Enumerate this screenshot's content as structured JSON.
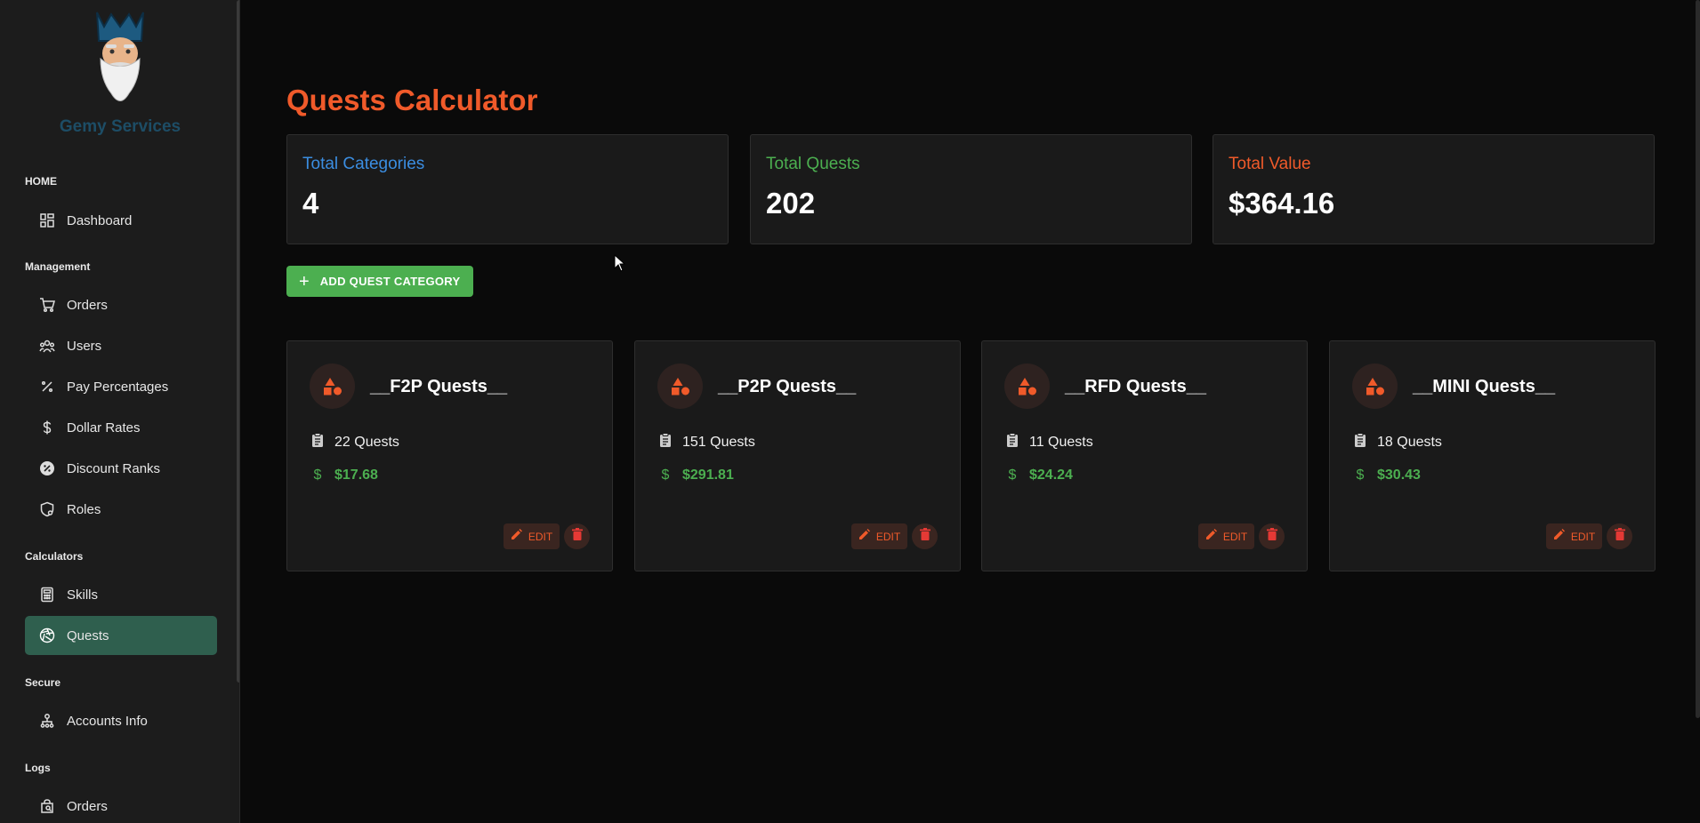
{
  "colors": {
    "accent": "#f05a2a",
    "green": "#4caf50",
    "blue": "#3b8de0",
    "activeNav": "#2f5f4e"
  },
  "sidebar": {
    "brand": "Gemy Services",
    "sections": {
      "home": "HOME",
      "management": "Management",
      "calculators": "Calculators",
      "secure": "Secure",
      "logs": "Logs"
    },
    "items": [
      {
        "label": "Dashboard",
        "icon": "dashboard-icon"
      },
      {
        "label": "Orders",
        "icon": "cart-icon"
      },
      {
        "label": "Users",
        "icon": "users-icon"
      },
      {
        "label": "Pay Percentages",
        "icon": "percent-icon"
      },
      {
        "label": "Dollar Rates",
        "icon": "dollar-icon"
      },
      {
        "label": "Discount Ranks",
        "icon": "discount-icon"
      },
      {
        "label": "Roles",
        "icon": "shield-icon"
      },
      {
        "label": "Skills",
        "icon": "calculator-icon"
      },
      {
        "label": "Quests",
        "icon": "aperture-icon",
        "active": true
      },
      {
        "label": "Accounts Info",
        "icon": "account-tree-icon"
      },
      {
        "label": "Orders",
        "icon": "bag-search-icon"
      }
    ]
  },
  "main": {
    "title": "Quests Calculator",
    "stats": [
      {
        "label": "Total Categories",
        "value": "4"
      },
      {
        "label": "Total Quests",
        "value": "202"
      },
      {
        "label": "Total Value",
        "value": "$364.16"
      }
    ],
    "add_button": "ADD QUEST CATEGORY",
    "categories": [
      {
        "name": "__F2P Quests__",
        "quests": "22 Quests",
        "value": "$17.68",
        "edit": "EDIT"
      },
      {
        "name": "__P2P Quests__",
        "quests": "151 Quests",
        "value": "$291.81",
        "edit": "EDIT"
      },
      {
        "name": "__RFD Quests__",
        "quests": "11 Quests",
        "value": "$24.24",
        "edit": "EDIT"
      },
      {
        "name": "__MINI Quests__",
        "quests": "18 Quests",
        "value": "$30.43",
        "edit": "EDIT"
      }
    ]
  }
}
